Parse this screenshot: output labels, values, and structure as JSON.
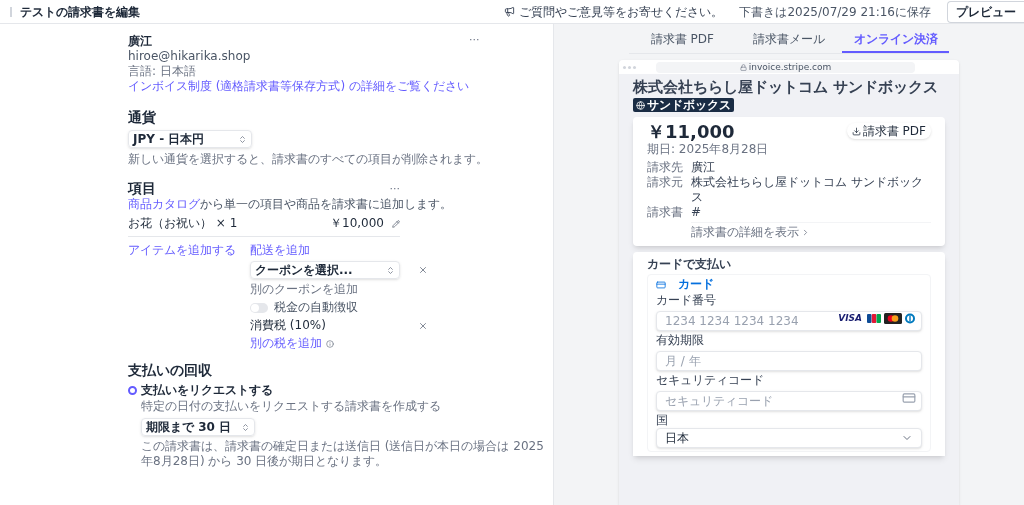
{
  "header": {
    "title": "テストの請求書を編集",
    "feedback": "ご質問やご意見等をお寄せください。",
    "saved": "下書きは2025/07/29 21:16に保存",
    "preview_button": "プレビュー"
  },
  "customer": {
    "name": "廣江",
    "email": "hiroe@hikarika.shop",
    "language": "言語: 日本語",
    "link": "インボイス制度 (適格請求書等保存方式) の詳細をご覧ください",
    "menu": "···"
  },
  "currency": {
    "heading": "通貨",
    "value": "JPY - 日本円",
    "note": "新しい通貨を選択すると、請求書のすべての項目が削除されます。"
  },
  "items": {
    "heading": "項目",
    "menu": "···",
    "catalog_link": "商品カタログ",
    "catalog_text": "から単一の項目や商品を請求書に追加します。",
    "rows": [
      {
        "name": "お花（お祝い） × 1",
        "amount": "￥10,000"
      }
    ],
    "add_item": "アイテムを追加する",
    "add_shipping": "配送を追加",
    "coupon_placeholder": "クーポンを選択...",
    "add_coupon": "別のクーポンを追加",
    "auto_tax": {
      "label": "税金の自動徴収",
      "on": false
    },
    "tax": "消費税 (10%)",
    "add_tax": "別の税を追加"
  },
  "collection": {
    "heading": "支払いの回収",
    "options": [
      {
        "label": "支払いをリクエストする",
        "description": "特定の日付の支払いをリクエストする請求書を作成する",
        "selected": true
      }
    ],
    "due": "期限まで 30 日",
    "due_note": "この請求書は、請求書の確定日または送信日 (送信日が本日の場合は 2025年8月28日) から 30 日後が期日となります。"
  },
  "preview": {
    "tabs": [
      {
        "label": "請求書 PDF",
        "selected": false
      },
      {
        "label": "請求書メール",
        "selected": false
      },
      {
        "label": "オンライン決済",
        "selected": true
      }
    ],
    "url": "invoice.stripe.com",
    "company": "株式会社ちらし屋ドットコム サンドボックス",
    "badge": "サンドボックス",
    "amount": "￥11,000",
    "due_date": "期日: 2025年8月28日",
    "pdf_button": "請求書 PDF",
    "details": [
      {
        "label": "請求先",
        "value": "廣江"
      },
      {
        "label": "請求元",
        "value": "株式会社ちらし屋ドットコム サンドボックス"
      },
      {
        "label": "請求書",
        "value": "#"
      }
    ],
    "details_link": "請求書の詳細を表示",
    "payment": {
      "heading": "カードで支払い",
      "method": "カード",
      "card_brand": "VISA",
      "fields": [
        {
          "label": "カード番号",
          "placeholder": "1234 1234 1234 1234",
          "kind": "card"
        },
        {
          "label": "有効期限",
          "placeholder": "月 / 年",
          "kind": "plain"
        },
        {
          "label": "セキュリティコード",
          "placeholder": "セキュリティコード",
          "kind": "cvc"
        },
        {
          "label": "国",
          "value": "日本",
          "kind": "select"
        }
      ]
    }
  }
}
